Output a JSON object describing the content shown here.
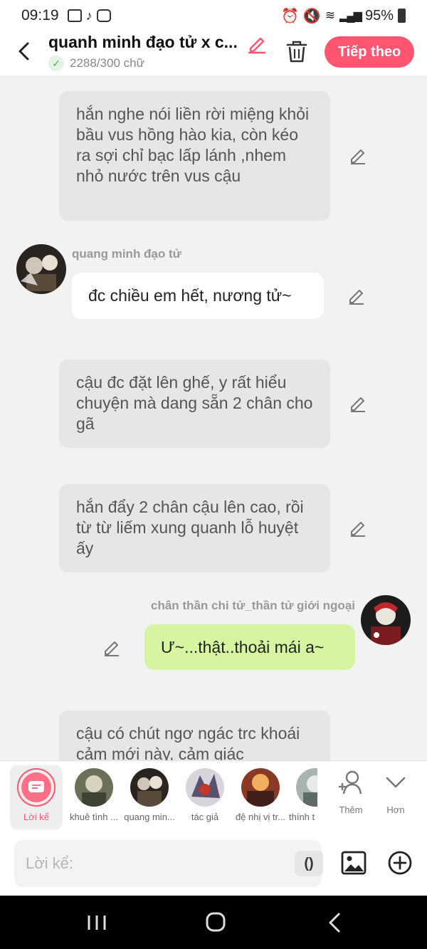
{
  "status": {
    "time": "09:19",
    "battery": "95%"
  },
  "header": {
    "title": "quanh minh đạo tử x c...",
    "word_count": "2288/300 chữ",
    "next_label": "Tiếp theo"
  },
  "messages": [
    {
      "kind": "narration",
      "text": "hắn nghe nói liền rời miệng khỏi bầu vus hồng hào kia, còn kéo ra sợi chỉ bạc lấp lánh ,nhem nhỏ nước trên vus cậu"
    },
    {
      "kind": "left",
      "speaker": "quang minh đạo tử",
      "text": "đc chiều em hết, nương tử~"
    },
    {
      "kind": "narration",
      "text": "cậu đc đặt lên ghế, y rất hiểu chuyện mà dang sẵn 2 chân cho gã"
    },
    {
      "kind": "narration",
      "text": "hắn đẩy 2 chân cậu lên cao, rồi từ từ liếm xung quanh lỗ huyệt ấy"
    },
    {
      "kind": "right",
      "speaker": "chân thần chi tử_thần tử giới ngoại",
      "text": "Ư~...thật..thoải mái a~"
    },
    {
      "kind": "narration",
      "text": "cậu có chút ngơ ngác trc khoái cảm mới này, cảm giác"
    }
  ],
  "characters": [
    {
      "label": "Lời kể"
    },
    {
      "label": "khuê tình ..."
    },
    {
      "label": "quang min..."
    },
    {
      "label": "tác giả"
    },
    {
      "label": "đệ nhị vị tr..."
    },
    {
      "label": "thính t"
    }
  ],
  "actions": {
    "add_label": "Thêm",
    "more_label": "Hơn"
  },
  "input": {
    "placeholder": "Lời kể:",
    "paren_label": "()"
  },
  "colors": {
    "accent": "#ff5571",
    "green_bubble": "#d6f5a0",
    "narration_bg": "#e6e6e6"
  }
}
